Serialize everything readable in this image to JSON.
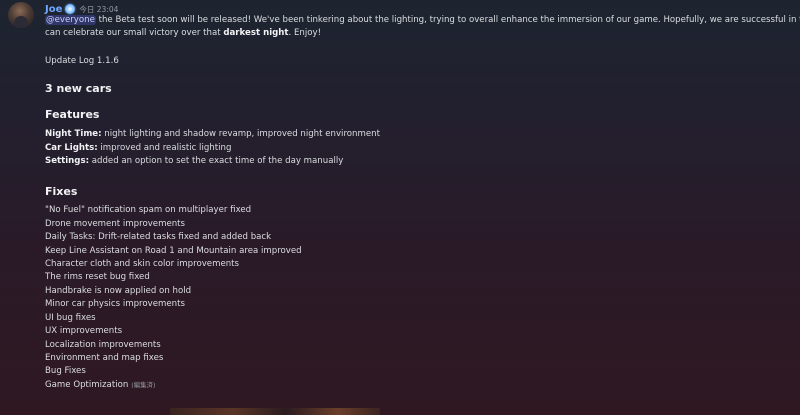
{
  "author": {
    "name": "Joe",
    "timestamp": "今日 23:04",
    "badge_icon": "verified-badge-icon",
    "name_color": "#6ea8ff"
  },
  "message": {
    "intro": {
      "mention": "@everyone",
      "line1_text": " the Beta test soon will be released! We've been tinkering about the lighting, trying to overall enhance the immersion of our game. Hopefully, we are successful in that and",
      "line2_prefix": "can celebrate our small victory over that ",
      "line2_bold": "darkest night",
      "line2_suffix": ". Enjoy!"
    },
    "update_log": "Update Log 1.1.6",
    "new_cars_heading": "3 new cars",
    "features_heading": "Features",
    "features": [
      {
        "label": "Night Time:",
        "text": " night lighting and shadow revamp, improved night environment"
      },
      {
        "label": "Car Lights:",
        "text": " improved and realistic lighting"
      },
      {
        "label": "Settings:",
        "text": " added an option to set the exact time of the day manually"
      }
    ],
    "fixes_heading": "Fixes",
    "fixes": [
      "\"No Fuel\" notification spam on multiplayer fixed",
      "Drone movement improvements",
      "Daily Tasks: Drift-related tasks fixed and added back",
      "Keep Line Assistant on Road 1 and Mountain area improved",
      "Character cloth and skin color improvements",
      "The rims reset bug fixed",
      "Handbrake is now applied on hold",
      "Minor car physics improvements",
      "UI bug fixes",
      "UX improvements",
      "Localization improvements",
      "Environment and map fixes",
      "Bug Fixes",
      "Game Optimization"
    ],
    "edited_label": "(編集済)"
  },
  "colors": {
    "mention_bg": "rgba(88,101,242,0.3)",
    "text": "#dbdee1",
    "muted": "#949ba4"
  }
}
